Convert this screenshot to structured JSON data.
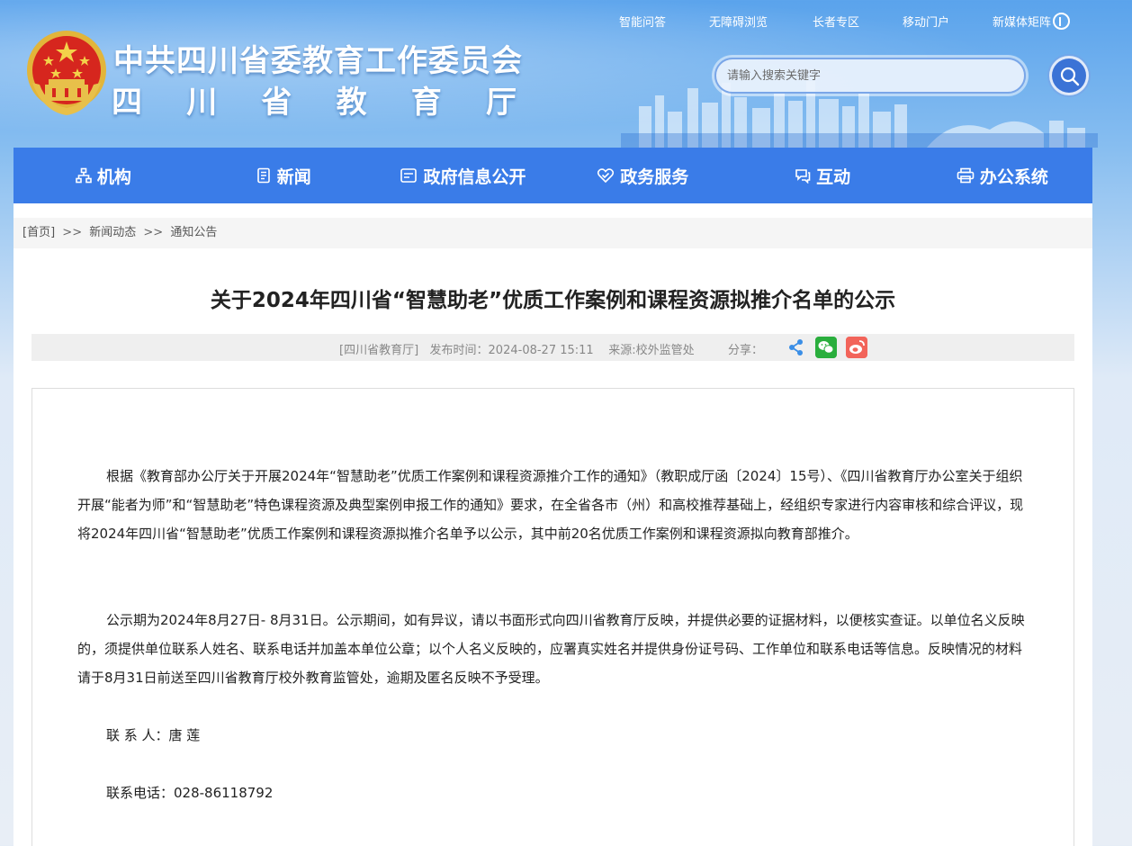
{
  "header": {
    "title_line1": "中共四川省委教育工作委员会",
    "title_line2_chars": [
      "四",
      "川",
      "省",
      "教",
      "育",
      "厅"
    ],
    "top_links": [
      "智能问答",
      "无障碍浏览",
      "长者专区",
      "移动门户",
      "新媒体矩阵"
    ],
    "search_placeholder": "请输入搜索关键字"
  },
  "nav": {
    "items": [
      {
        "label": "机构",
        "icon": "org-chart-icon"
      },
      {
        "label": "新闻",
        "icon": "news-icon"
      },
      {
        "label": "政府信息公开",
        "icon": "info-open-icon"
      },
      {
        "label": "政务服务",
        "icon": "heart-service-icon"
      },
      {
        "label": "互动",
        "icon": "chat-icon"
      },
      {
        "label": "办公系统",
        "icon": "printer-icon"
      }
    ]
  },
  "breadcrumb": {
    "home": "[首页]",
    "sep": ">>",
    "level1": "新闻动态",
    "level2": "通知公告"
  },
  "article": {
    "title": "关于2024年四川省“智慧助老”优质工作案例和课程资源拟推介名单的公示",
    "meta": "[四川省教育厅]   发布时间：2024-08-27 15:11    来源:校外监管处",
    "share_label": "分享：",
    "paragraphs": [
      "根据《教育部办公厅关于开展2024年“智慧助老”优质工作案例和课程资源推介工作的通知》（教职成厅函〔2024〕15号）、《四川省教育厅办公室关于组织开展“能者为师”和“智慧助老”特色课程资源及典型案例申报工作的通知》要求，在全省各市（州）和高校推荐基础上，经组织专家进行内容审核和综合评议，现将2024年四川省“智慧助老”优质工作案例和课程资源拟推介名单予以公示，其中前20名优质工作案例和课程资源拟向教育部推介。",
      "公示期为2024年8月27日- 8月31日。公示期间，如有异议，请以书面形式向四川省教育厅反映，并提供必要的证据材料，以便核实查证。以单位名义反映的，须提供单位联系人姓名、联系电话并加盖本单位公章；以个人名义反映的，应署真实姓名并提供身份证号码、工作单位和联系电话等信息。反映情况的材料请于8月31日前送至四川省教育厅校外教育监管处，逾期及匿名反映不予受理。",
      "联 系 人：唐 莲",
      "联系电话：028-86118792"
    ]
  },
  "colors": {
    "nav_bg": "#3a7ce8",
    "search_button": "#3b73d6",
    "wechat_green": "#2aae3d",
    "weibo_red": "#f2645a",
    "title_text": "#222222"
  }
}
